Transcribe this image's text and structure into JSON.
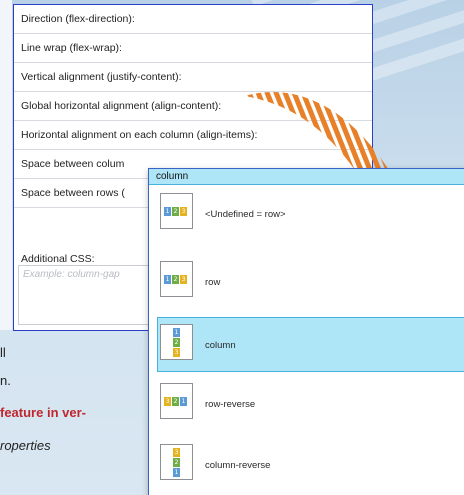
{
  "form": {
    "rows": [
      {
        "label": "Direction (flex-direction):"
      },
      {
        "label": "Line wrap (flex-wrap):"
      },
      {
        "label": "Vertical alignment (justify-content):"
      },
      {
        "label": "Global horizontal alignment (align-content):"
      },
      {
        "label": "Horizontal alignment on each column (align-items):"
      },
      {
        "label": "Space between colum"
      },
      {
        "label": "Space between rows ("
      }
    ],
    "css_label": "Additional CSS:",
    "css_placeholder": "Example: column-gap"
  },
  "dropdown": {
    "header": "column",
    "selected_index": 2,
    "options": [
      {
        "label": "<Undefined = row>",
        "icon": "flex-row-icon",
        "numbers": [
          "1",
          "2",
          "3"
        ]
      },
      {
        "label": "row",
        "icon": "flex-row-icon",
        "numbers": [
          "1",
          "2",
          "3"
        ]
      },
      {
        "label": "column",
        "icon": "flex-column-icon",
        "numbers": [
          "1",
          "2",
          "3"
        ]
      },
      {
        "label": "row-reverse",
        "icon": "flex-row-reverse-icon",
        "numbers": [
          "3",
          "2",
          "1"
        ]
      },
      {
        "label": "column-reverse",
        "icon": "flex-column-reverse-icon",
        "numbers": [
          "3",
          "2",
          "1"
        ]
      }
    ]
  },
  "background_text": {
    "line1": "ll",
    "line2": "n.",
    "line3": "feature in ver-",
    "line4": "roperties"
  },
  "colors": {
    "accent_border": "#2b3fc8",
    "selection": "#aee6f7",
    "arrow": "#e8802a",
    "cell_blue": "#5b9bd5",
    "cell_green": "#70ad47",
    "cell_yellow": "#e4b322",
    "highlight_red": "#c0262e"
  }
}
